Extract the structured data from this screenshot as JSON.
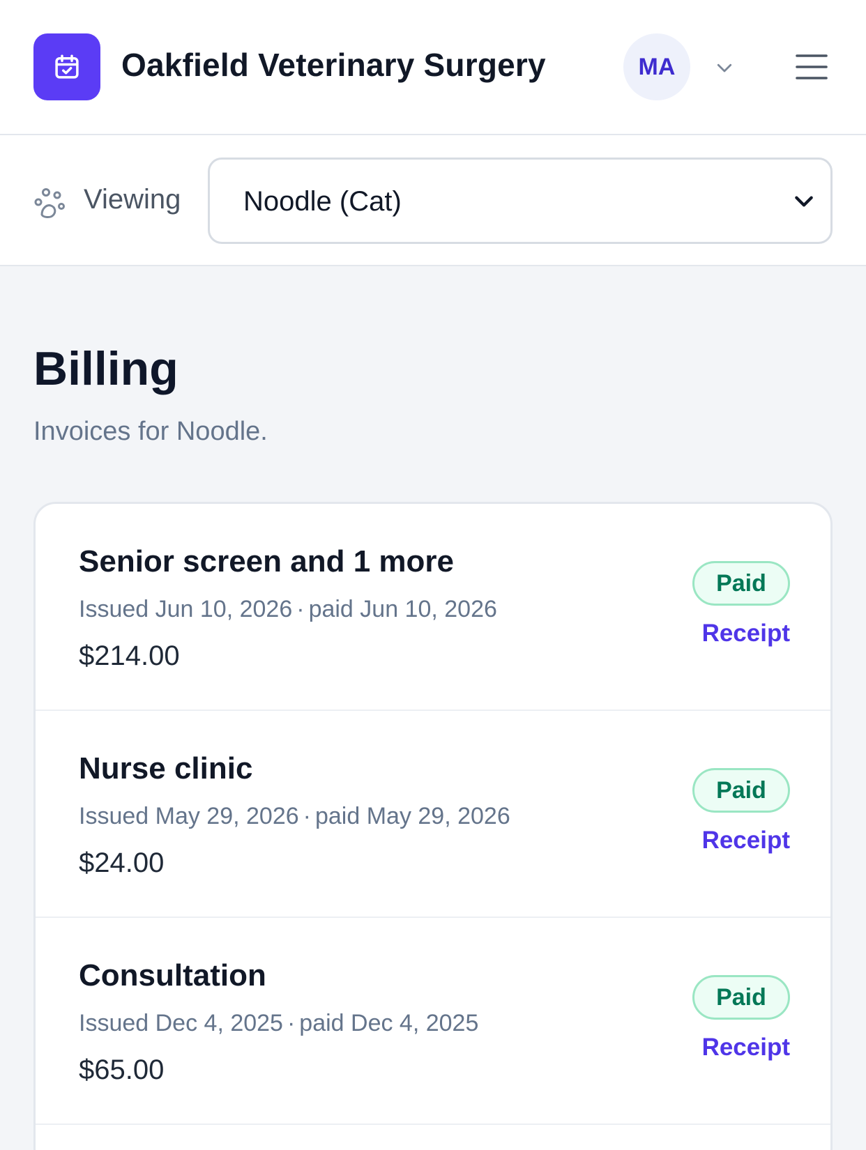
{
  "app": {
    "title": "Oakfield Veterinary Surgery",
    "logo_icon": "calendar-check-icon",
    "accent_color": "#5b3cf5"
  },
  "user": {
    "initials": "MA"
  },
  "pet_selector": {
    "label": "Viewing",
    "selected": "Noodle (Cat)",
    "icon": "paw-icon"
  },
  "page": {
    "title": "Billing",
    "subtitle": "Invoices for Noodle."
  },
  "invoices": [
    {
      "title": "Senior screen and 1 more",
      "issued": "Issued Jun 10, 2026",
      "paid": "paid Jun 10, 2026",
      "amount": "$214.00",
      "status": "Paid",
      "action": "Receipt"
    },
    {
      "title": "Nurse clinic",
      "issued": "Issued May 29, 2026",
      "paid": "paid May 29, 2026",
      "amount": "$24.00",
      "status": "Paid",
      "action": "Receipt"
    },
    {
      "title": "Consultation",
      "issued": "Issued Dec 4, 2025",
      "paid": "paid Dec 4, 2025",
      "amount": "$65.00",
      "status": "Paid",
      "action": "Receipt"
    }
  ],
  "colors": {
    "paid_text": "#047857",
    "paid_bg": "#ecfdf5",
    "link": "#4f35e8"
  }
}
